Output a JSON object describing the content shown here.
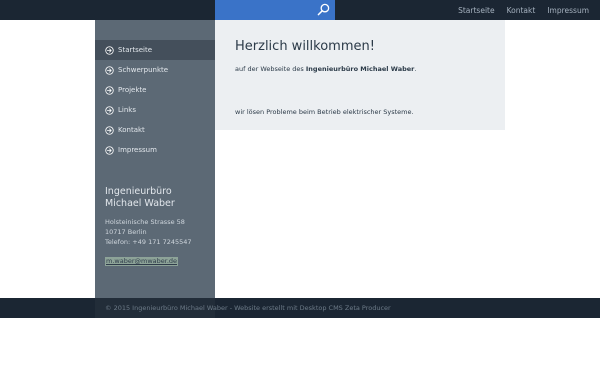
{
  "topnav": {
    "items": [
      {
        "label": "Startseite"
      },
      {
        "label": "Kontakt"
      },
      {
        "label": "Impressum"
      }
    ]
  },
  "search": {
    "icon": "search-icon"
  },
  "sidebar": {
    "menu": [
      {
        "label": "Startseite",
        "active": true
      },
      {
        "label": "Schwerpunkte"
      },
      {
        "label": "Projekte"
      },
      {
        "label": "Links"
      },
      {
        "label": "Kontakt"
      },
      {
        "label": "Impressum"
      }
    ],
    "contact": {
      "name_line1": "Ingenieurbüro",
      "name_line2": "Michael Waber",
      "street": "Holsteinische Strasse 58",
      "city": "10717 Berlin",
      "phone": "Telefon: +49 171 7245547",
      "email": "m.waber@mwaber.de"
    }
  },
  "main": {
    "heading": "Herzlich willkommen!",
    "intro_prefix": "auf der Webseite des ",
    "intro_company": "Ingenieurbüro Michael Waber",
    "intro_suffix": ".",
    "tagline": "wir lösen Probleme beim Betrieb elektrischer Systeme."
  },
  "footer": {
    "text": "© 2015 Ingenieurbüro Michael Waber - Website erstellt mit Desktop CMS Zeta Producer"
  },
  "colors": {
    "topbar": "#1b2633",
    "search_accent": "#3a73c8",
    "sidebar": "#5c6975",
    "sidebar_active": "#444f5b",
    "content_bg": "#eceff2"
  }
}
